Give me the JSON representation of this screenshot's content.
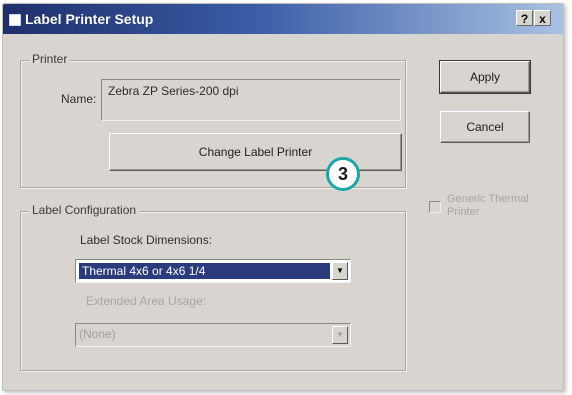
{
  "window": {
    "title": "Label Printer Setup",
    "help_button": "?",
    "close_button": "x"
  },
  "printer_group": {
    "legend": "Printer",
    "name_label": "Name:",
    "name_value": "Zebra  ZP Series-200 dpi",
    "change_button": "Change Label Printer"
  },
  "side_buttons": {
    "apply": "Apply",
    "cancel": "Cancel"
  },
  "generic_thermal": {
    "label_line1": "Generic Thermal",
    "label_line2": "Printer",
    "checked": false
  },
  "label_config": {
    "legend": "Label Configuration",
    "stock_label": "Label Stock Dimensions:",
    "stock_value": "Thermal 4x6 or 4x6 1/4",
    "extended_label": "Extended Area Usage:",
    "extended_value": "(None)"
  },
  "callout": {
    "number": "3"
  },
  "icons": {
    "window": "window-icon",
    "dropdown": "chevron-down-icon"
  }
}
